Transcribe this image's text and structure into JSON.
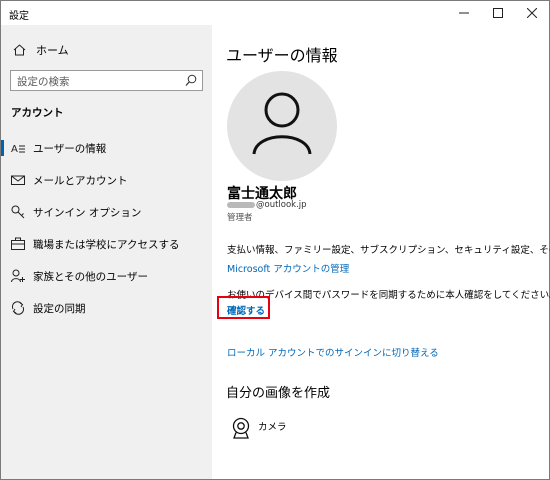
{
  "window": {
    "title": "設定",
    "controls": [
      "minimize-icon",
      "maximize-icon",
      "close-icon"
    ]
  },
  "sidebar": {
    "home_label": "ホーム",
    "search_placeholder": "設定の検索",
    "section_title": "アカウント",
    "items": [
      {
        "label": "ユーザーの情報",
        "icon": "user-info-icon",
        "active": true
      },
      {
        "label": "メールとアカウント",
        "icon": "mail-icon",
        "active": false
      },
      {
        "label": "サインイン オプション",
        "icon": "key-icon",
        "active": false
      },
      {
        "label": "職場または学校にアクセスする",
        "icon": "briefcase-icon",
        "active": false
      },
      {
        "label": "家族とその他のユーザー",
        "icon": "person-add-icon",
        "active": false
      },
      {
        "label": "設定の同期",
        "icon": "sync-icon",
        "active": false
      }
    ]
  },
  "main": {
    "title": "ユーザーの情報",
    "user_name": "富士通太郎",
    "email_domain": "@outlook.jp",
    "role": "管理者",
    "billing_text": "支払い情報、ファミリー設定、サブスクリプション、セキュリティ設定、その他",
    "manage_link": "Microsoft アカウントの管理",
    "verify_text": "お使いのデバイス間でパスワードを同期するために本人確認をしてください。",
    "verify_link": "確認する",
    "local_link": "ローカル アカウントでのサインインに切り替える",
    "create_picture_title": "自分の画像を作成",
    "camera_label": "カメラ"
  },
  "colors": {
    "accent": "#0067b8",
    "highlight_box": "#e60012",
    "sidebar_bg": "#f0f0f0",
    "avatar_bg": "#e3e3e3"
  }
}
